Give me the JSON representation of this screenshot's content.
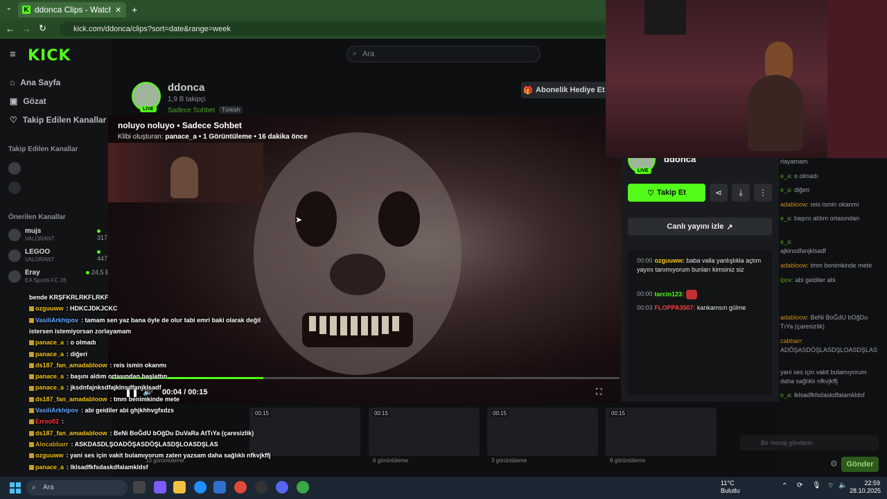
{
  "browser": {
    "tab_title": "ddonca Clips - Watch Live c",
    "url": "kick.com/ddonca/clips?sort=date&range=week"
  },
  "kick": {
    "logo": "KICK",
    "search_placeholder": "Ara",
    "nav": [
      {
        "label": "Ana Sayfa"
      },
      {
        "label": "Gözat"
      },
      {
        "label": "Takip Edilen Kanallar"
      }
    ],
    "followed_heading": "Takip Edilen Kanallar",
    "recommended_heading": "Önerilen Kanallar",
    "recommended": [
      {
        "name": "mujs",
        "category": "VALORANT",
        "viewers": "317"
      },
      {
        "name": "LEGOO",
        "category": "VALORANT",
        "viewers": "447"
      },
      {
        "name": "Eray",
        "category": "EA Sports FC 26",
        "viewers": "24,5 E"
      }
    ],
    "channel": {
      "name": "ddonca",
      "followers": "1,9 B takipçi",
      "category": "Sadece Sohbet",
      "language": "Türkish",
      "live_badge": "LIVE",
      "gift_sub": "Abonelik Hediye Et"
    }
  },
  "clip": {
    "title": "noluyo noluyo • Sadece Sohbet",
    "meta_prefix": "Klibi oluşturan:",
    "creator": "panace_a",
    "views": "• 1 Görüntüleme •",
    "ago": "16 dakika önce",
    "time": "00:04 / 00:15",
    "progress_fraction": 0.3
  },
  "panel": {
    "name": "ddonca",
    "live_badge": "LIVE",
    "follow": "Takip Et",
    "watch_live": "Canlı yayını izle",
    "chat": [
      {
        "time": "00:00",
        "user": "ozguuww",
        "user_color": "#f5c518",
        "text": "baba valla yanlışlıkla açtım yayını tanımıyorum bunları kimsiniz siz"
      },
      {
        "time": "00:00",
        "user": "tarcin123",
        "user_color": "#53fc18",
        "text": ""
      },
      {
        "time": "00:03",
        "user": "FLOPPA3507",
        "user_color": "#ff3b3b",
        "text": "kankamsın gülme"
      }
    ]
  },
  "overlay_chat": [
    {
      "user": "",
      "text": "bende KRŞFKRLRKFLRKF",
      "color": "#ffffff"
    },
    {
      "user": "ozguuww",
      "text": ": HDKCJDKJCKC",
      "color": "#f5c518"
    },
    {
      "user": "VasiliArkhipov",
      "text": ": tamam sen yaz bana öyle de olur tabi emri baki olarak değil",
      "color": "#6aa8ff"
    },
    {
      "user": "",
      "text": "istersen istemiyorsan zorlayamam",
      "color": "#ffffff"
    },
    {
      "user": "panace_a",
      "text": ": o olmadı",
      "color": "#f5c518"
    },
    {
      "user": "panace_a",
      "text": ": diğeri",
      "color": "#f5c518"
    },
    {
      "user": "ds187_fan_amadabloow",
      "text": ": reis ismin okanmı",
      "color": "#f5c518"
    },
    {
      "user": "panace_a",
      "text": ": başını aldım ortasından başlattın",
      "color": "#f5c518"
    },
    {
      "user": "panace_a",
      "text": ": jksdnfajnksdfajklnsdfanjklsadf",
      "color": "#f5c518"
    },
    {
      "user": "ds187_fan_amadabloow",
      "text": ": tmm benimkinde mete",
      "color": "#f5c518"
    },
    {
      "user": "VasiliArkhipov",
      "text": ": abi geidiler abi ghjkhhvgfxdzs",
      "color": "#6aa8ff"
    },
    {
      "user": "Erroo02",
      "text": ":",
      "color": "#ff3b3b"
    },
    {
      "user": "ds187_fan_amadabloow",
      "text": ": BeNi BoĞdU bOğDu DuVaRa AtTıYa (çaresizlik)",
      "color": "#f5c518"
    },
    {
      "user": "Alocabbarr",
      "text": ": ASKDASDLŞOADÖŞASDÖŞLASDŞLOASDŞLAS",
      "color": "#c9a227"
    },
    {
      "user": "ozguuww",
      "text": ": yani ses için vakit bulamıyorum zaten yazsam daha sağlıklı nfkvjkffj",
      "color": "#f5c518"
    },
    {
      "user": "panace_a",
      "text": ": lklsadfkfsdaskdfalamkldsf",
      "color": "#f5c518"
    }
  ],
  "right_chat": [
    {
      "text": "rlayamam"
    },
    {
      "user": "e_a:",
      "text": "o olmadı"
    },
    {
      "user": "e_a:",
      "text": "diğeri"
    },
    {
      "user": "adabloow:",
      "text": "reis ismin okanmı"
    },
    {
      "user": "e_a:",
      "text": "başını aldım ortasından"
    },
    {
      "user": "e_a:",
      "text": ""
    },
    {
      "text": "ajkinsdfanjklsadf"
    },
    {
      "user": "adabloow:",
      "text": "tmm benimkinde mete"
    },
    {
      "user": "ipov:",
      "text": "abi geidiler abi"
    },
    {
      "user": "adabloow:",
      "text": "BeNi BoĞdU bOğDu"
    },
    {
      "text": "TıYa (çaresizlik)"
    },
    {
      "user": "cabbarr:",
      "text": ""
    },
    {
      "text": "ADÖŞASDÖŞLASDŞLOASDŞLAS"
    },
    {
      "text": "yani ses için vakit bulamıyorum"
    },
    {
      "text": "daha sağlıklı nfkvjkffj"
    },
    {
      "user": "e_a:",
      "text": "lklsadfkfsdaskdfalamkldsf"
    }
  ],
  "chat_input": {
    "placeholder": "Bir mesaj gönderin",
    "send": "Gönder"
  },
  "thumbs": [
    {
      "dur": "00:15",
      "views": "10 görüntüleme"
    },
    {
      "dur": "00:15",
      "views": "6 görüntüleme"
    },
    {
      "dur": "00:15",
      "views": "3 görüntüleme"
    },
    {
      "dur": "00:15",
      "views": "8 görüntüleme"
    }
  ],
  "taskbar": {
    "search": "Ara",
    "temp": "11°C",
    "weather": "Bulutlu",
    "time": "22:59",
    "date": "28.10.2025"
  }
}
